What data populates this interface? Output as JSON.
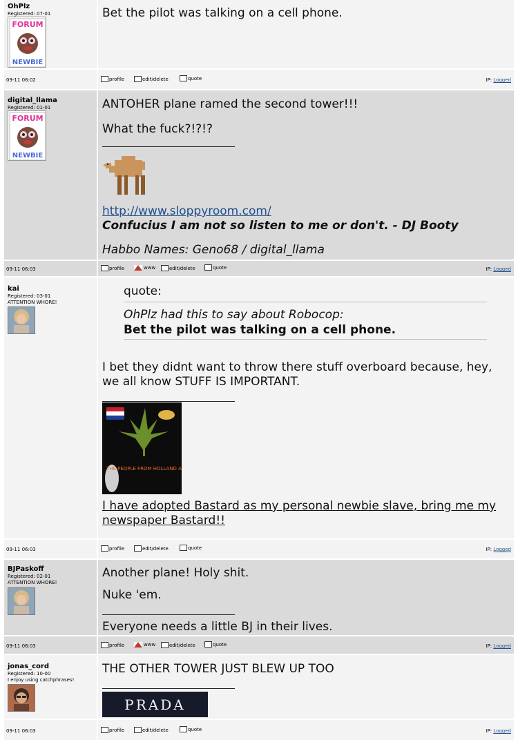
{
  "footer_labels": {
    "profile": "profile",
    "www": "www",
    "edit": "edit/delete",
    "quote": "quote",
    "ip_prefix": "IP:",
    "ip_link": "Logged"
  },
  "posts": [
    {
      "username": "OhPlz",
      "registered": "Registered: 07-01",
      "avatar": "forum-newbie-icon",
      "message": "Bet the pilot was talking on a cell phone.",
      "date": "09-11 06:02"
    },
    {
      "username": "digital_llama",
      "registered": "Registered: 01-01",
      "avatar": "forum-newbie-icon",
      "lines": [
        "ANTOHER plane ramed the second tower!!!",
        "What the fuck?!?!?"
      ],
      "sig_image": "camel-icon",
      "sig_link": "http://www.sloppyroom.com/",
      "sig_quote": "Confucius I am not so listen to me or don't. - DJ Booty",
      "sig_habbo": "Habbo Names: Geno68 / digital_llama",
      "date": "09-11 06:03"
    },
    {
      "username": "kai",
      "registered": "Registered: 03-01",
      "title": "ATTENTION WHORE!",
      "avatar": "photo-avatar",
      "quote_label": "quote:",
      "quote_attrib": "OhPlz had this to say about Robocop:",
      "quote_text": "Bet the pilot was talking on a cell phone.",
      "body_line1": "I bet they didnt want to throw there stuff overboard because, hey,",
      "body_line2": "we all know STUFF IS IMPORTANT.",
      "sig_banner_text": "THE PEOPLE FROM HOLLAND ARMY",
      "sig_line1": "I have adopted Bastard as my personal newbie slave, bring me my",
      "sig_line2": "newspaper Bastard!! ",
      "date": "09-11 06:03"
    },
    {
      "username": "BJPaskoff",
      "registered": "Registered: 02-01",
      "title": "ATTENTION WHORE!",
      "avatar": "photo-avatar",
      "lines": [
        "Another plane! Holy shit.",
        "Nuke 'em."
      ],
      "sig": "Everyone needs a little BJ in their lives.",
      "date": "09-11 06:03"
    },
    {
      "username": "jonas_cord",
      "registered": "Registered: 10-00",
      "title": "I enjoy using catchphrases!",
      "avatar": "photo-avatar",
      "message": "THE OTHER TOWER JUST BLEW UP TOO",
      "sig_banner_text": "PRADA",
      "date": "09-11 06:03"
    }
  ],
  "colors": {
    "row_light": "#f3f3f3",
    "row_dark": "#dadada",
    "link": "#1f4f8e"
  }
}
